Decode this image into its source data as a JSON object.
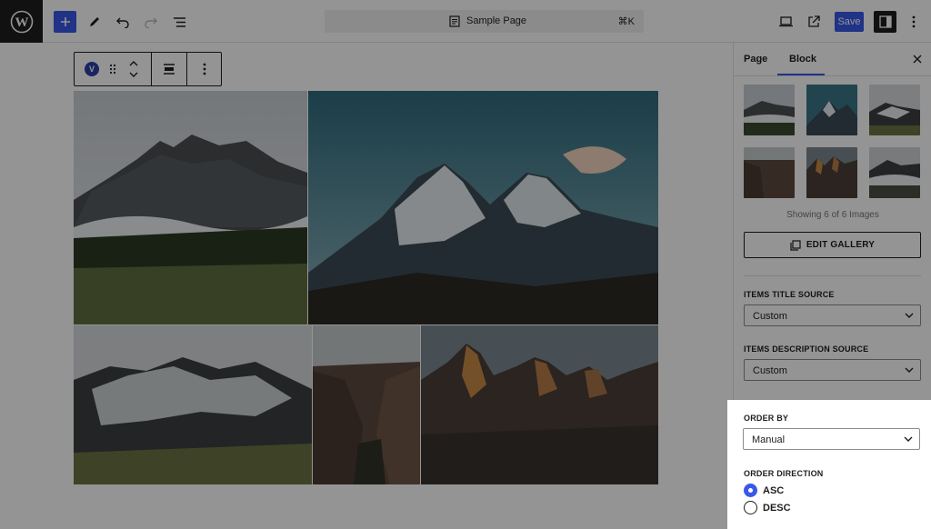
{
  "header": {
    "document_title": "Sample Page",
    "shortcut": "⌘K",
    "save_label": "Save",
    "icons": [
      "wordpress-logo",
      "plus-icon",
      "pencil-icon",
      "undo-icon",
      "redo-icon",
      "list-view-icon",
      "desktop-icon",
      "external-link-icon",
      "sidebar-icon",
      "more-vertical-icon"
    ]
  },
  "block_toolbar": {
    "badge": "V",
    "icons": [
      "block-badge",
      "drag-handle-icon",
      "move-arrows-icon",
      "align-icon",
      "more-vertical-icon"
    ]
  },
  "sidebar": {
    "tabs": [
      {
        "label": "Page",
        "active": false
      },
      {
        "label": "Block",
        "active": true
      }
    ],
    "showing_text": "Showing 6 of 6 Images",
    "edit_gallery_label": "EDIT GALLERY",
    "items_title_source": {
      "label": "ITEMS TITLE SOURCE",
      "value": "Custom"
    },
    "items_description_source": {
      "label": "ITEMS DESCRIPTION SOURCE",
      "value": "Custom"
    },
    "order_by": {
      "label": "ORDER BY",
      "value": "Manual"
    },
    "order_direction": {
      "label": "ORDER DIRECTION",
      "options": [
        {
          "label": "ASC",
          "checked": true
        },
        {
          "label": "DESC",
          "checked": false
        }
      ]
    }
  },
  "colors": {
    "accent": "#3858e9",
    "dark": "#1e1e1e"
  }
}
